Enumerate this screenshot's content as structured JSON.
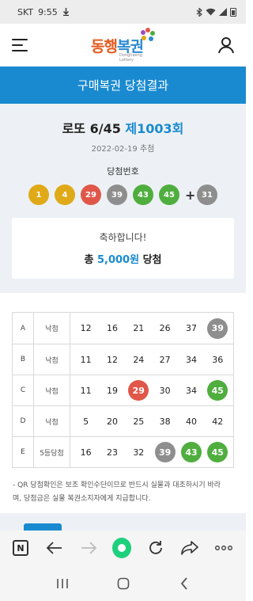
{
  "status_bar": {
    "carrier": "SKT",
    "time": "9:55"
  },
  "header": {
    "logo_text_a": "동행",
    "logo_text_b": "복권",
    "logo_sub": "Donghaeng Lottery"
  },
  "page": {
    "title": "구매복권 당첨결과"
  },
  "draw": {
    "game": "로또 6/45",
    "round": "제1003회",
    "date": "2022-02-19 추첨",
    "winning_label": "당첨번호",
    "winning_numbers": [
      "1",
      "4",
      "29",
      "39",
      "43",
      "45"
    ],
    "plus": "+",
    "bonus_number": "31"
  },
  "result": {
    "congrats": "축하합니다!",
    "prize_prefix": "총",
    "prize_amount": "5,000원",
    "prize_suffix": "당첨"
  },
  "ticket_rows": [
    {
      "letter": "A",
      "status": "낙첨",
      "numbers": [
        "12",
        "16",
        "21",
        "26",
        "37",
        "39"
      ]
    },
    {
      "letter": "B",
      "status": "낙첨",
      "numbers": [
        "11",
        "12",
        "24",
        "27",
        "34",
        "36"
      ]
    },
    {
      "letter": "C",
      "status": "낙첨",
      "numbers": [
        "11",
        "19",
        "29",
        "30",
        "34",
        "45"
      ]
    },
    {
      "letter": "D",
      "status": "낙첨",
      "numbers": [
        "5",
        "20",
        "25",
        "38",
        "40",
        "42"
      ]
    },
    {
      "letter": "E",
      "status": "5등당첨",
      "numbers": [
        "16",
        "23",
        "32",
        "39",
        "43",
        "45"
      ]
    }
  ],
  "ball_colors": {
    "1-10": "#e0a918",
    "11-20": "#2a8ad1",
    "21-30": "#e0574a",
    "31-40": "#8e8e8e",
    "41-45": "#4fae3e"
  },
  "notice": {
    "line1": "- QR 당첨확인은 보조 확인수단이므로 반드시 실물과 대조하시기 바라",
    "line2": "며, 당첨금은 실물 복권소지자에게 지급합니다."
  },
  "icons": [
    "menu-icon",
    "user-icon",
    "naver-icon",
    "back-arrow-icon",
    "forward-arrow-icon",
    "home-icon",
    "refresh-icon",
    "share-icon",
    "more-icon",
    "recent-apps-icon",
    "home-button-icon",
    "back-icon"
  ],
  "colors": {
    "accent": "#1a8ad0",
    "summary_bg": "#edf1f5"
  }
}
